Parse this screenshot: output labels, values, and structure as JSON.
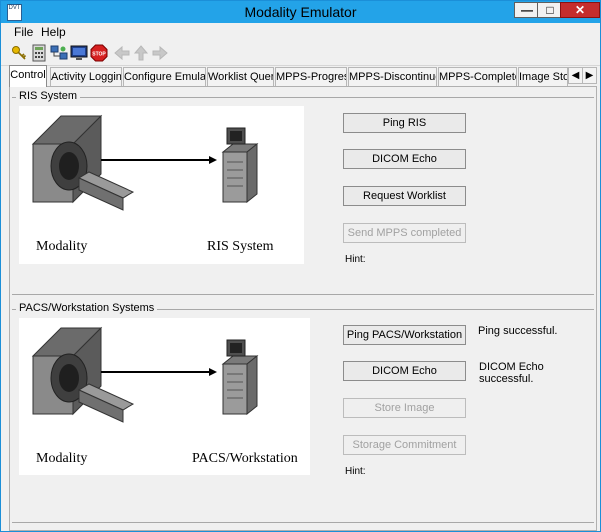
{
  "window": {
    "title": "Modality Emulator",
    "app_icon_text": "DVT",
    "minimize_glyph": "—",
    "maximize_glyph": "□",
    "close_glyph": "✕"
  },
  "menu": {
    "items": [
      "File",
      "Help"
    ]
  },
  "toolbar": {
    "icons": [
      "key-icon",
      "calculator-icon",
      "network-icon",
      "monitor-icon",
      "stop-icon",
      "arrow-left-icon",
      "arrow-up-icon",
      "arrow-right-icon"
    ],
    "stop_text": "STOP"
  },
  "tabs": {
    "items": [
      "Control",
      "Activity Logging",
      "Configure Emulator",
      "Worklist Query",
      "MPPS-Progress",
      "MPPS-Discontinued",
      "MPPS-Completed",
      "Image Stora"
    ],
    "active_index": 0,
    "scroll_left": "◀",
    "scroll_right": "▶"
  },
  "ris": {
    "group_title": "RIS System",
    "diagram": {
      "left_label": "Modality",
      "right_label": "RIS System"
    },
    "buttons": {
      "ping": "Ping RIS",
      "echo": "DICOM Echo",
      "worklist": "Request Worklist",
      "mpps": "Send MPPS completed"
    },
    "hint_label": "Hint:"
  },
  "pacs": {
    "group_title": "PACS/Workstation Systems",
    "diagram": {
      "left_label": "Modality",
      "right_label": "PACS/Workstation"
    },
    "buttons": {
      "ping": "Ping PACS/Workstation",
      "echo": "DICOM Echo",
      "store": "Store Image",
      "commit": "Storage Commitment"
    },
    "status": {
      "ping": "Ping successful.",
      "echo": "DICOM Echo successful."
    },
    "hint_label": "Hint:"
  },
  "colors": {
    "titlebar": "#23a3e8",
    "close_button": "#c52d2d",
    "window_bg": "#f0f0f0",
    "disabled_text": "#a1a1a1"
  }
}
